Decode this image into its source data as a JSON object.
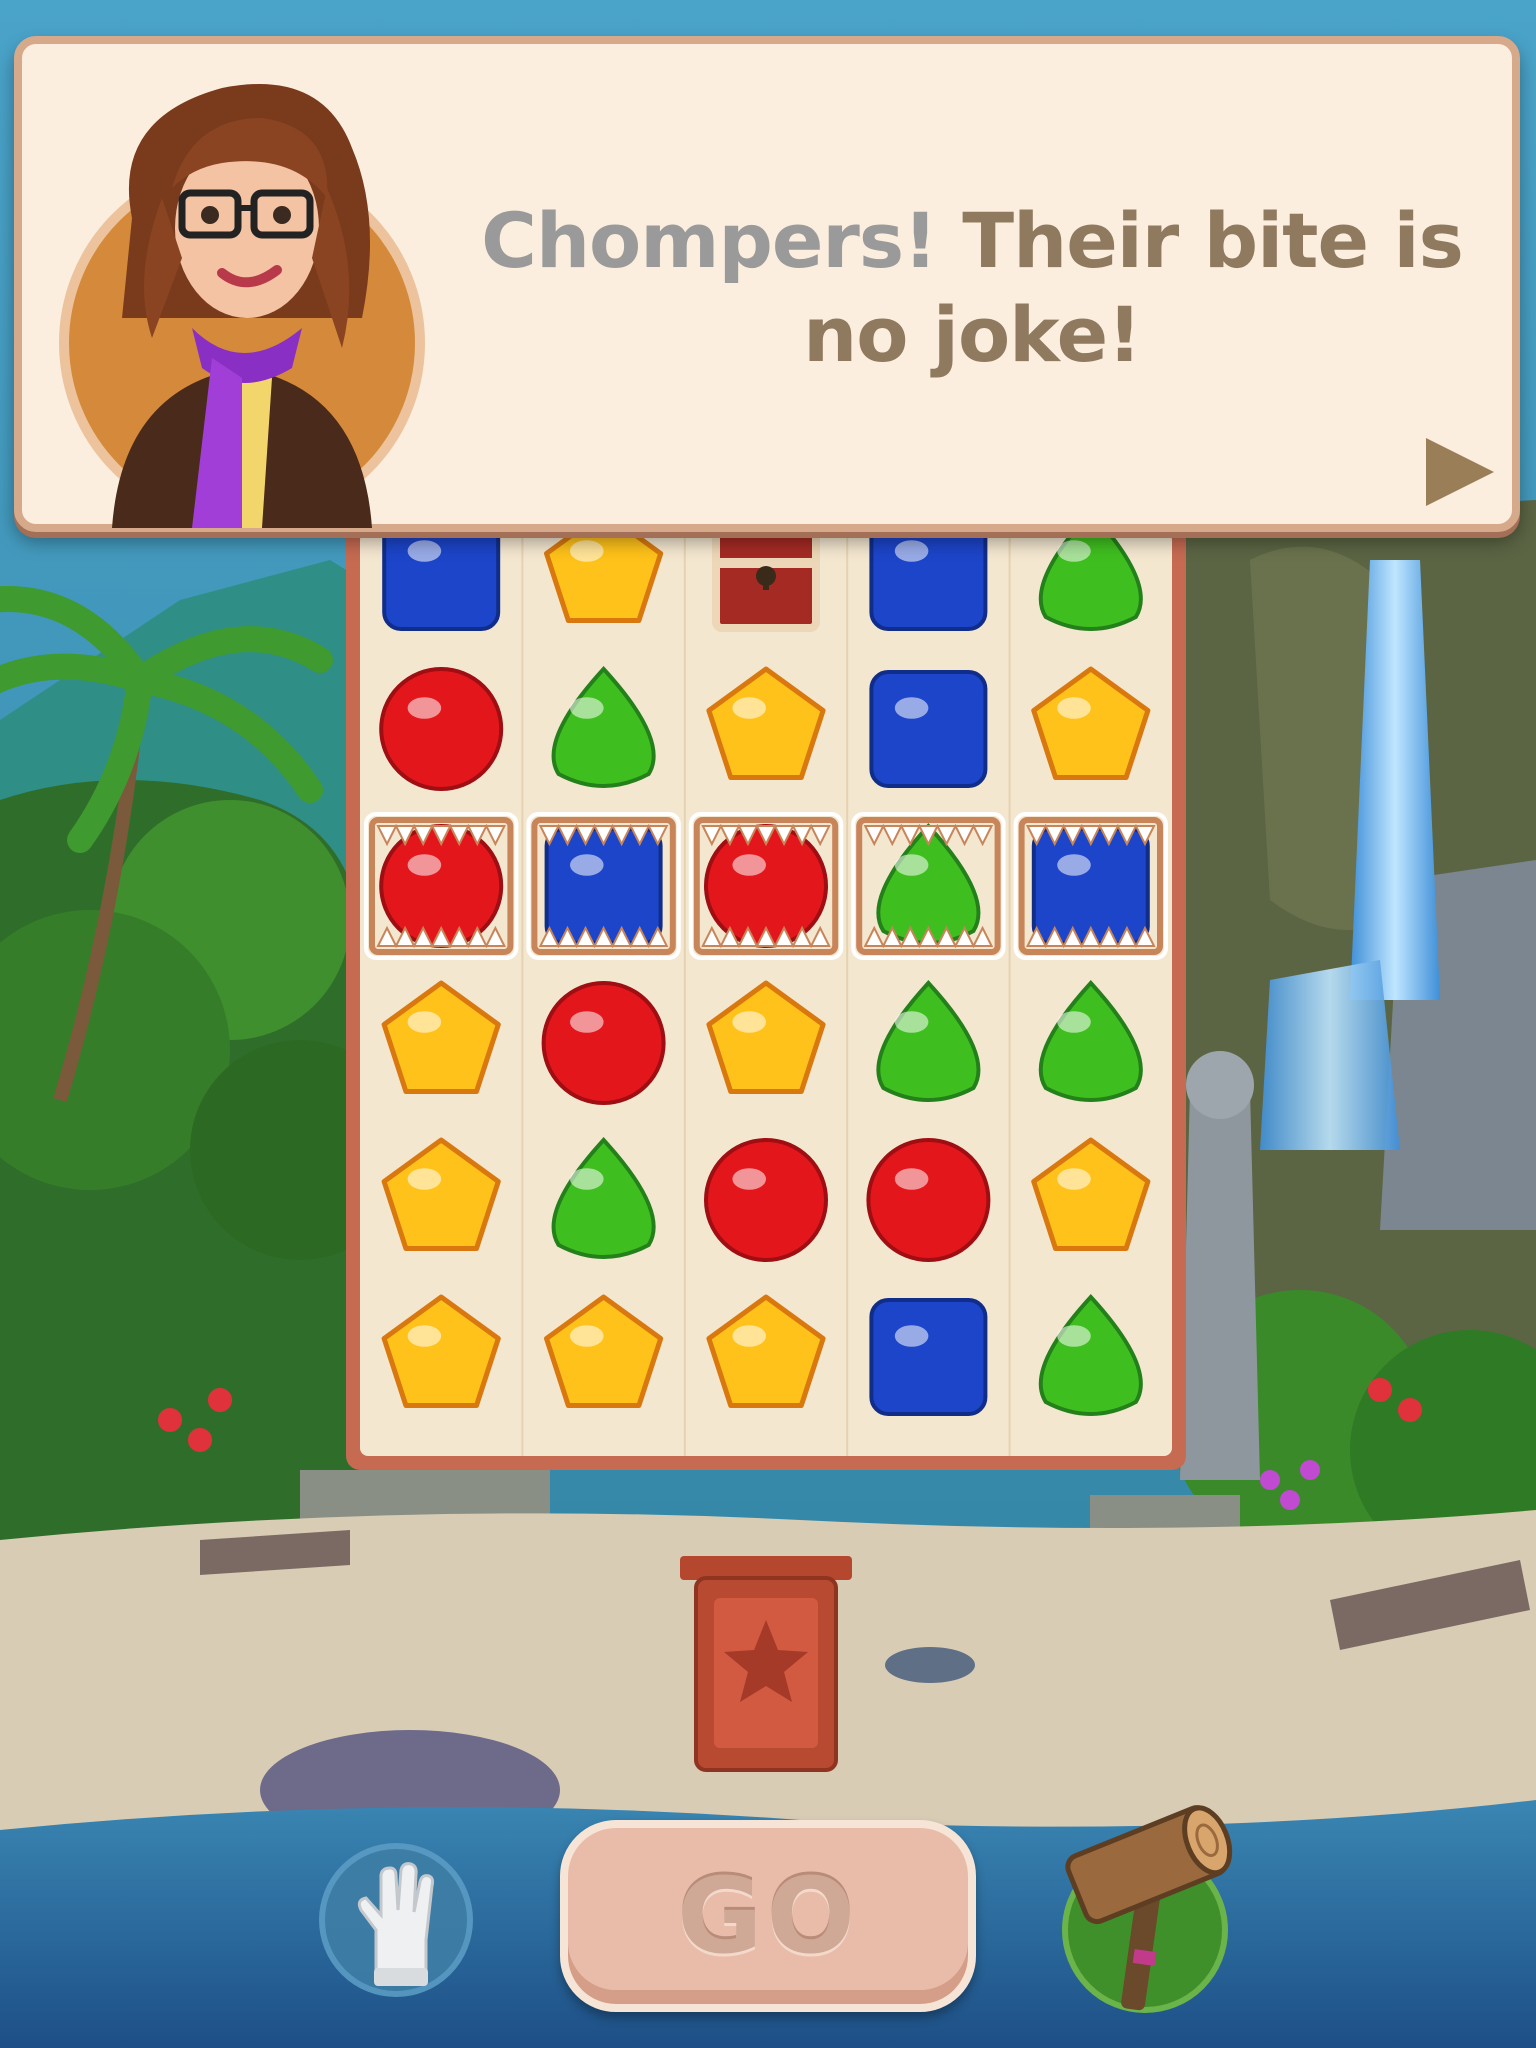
{
  "dialog": {
    "text_highlight": "Chompers!",
    "text_rest": "Their bite is no joke!",
    "next_icon": "play-arrow-icon"
  },
  "board": {
    "rows": 6,
    "cols": 5,
    "grid": [
      [
        "blue",
        "yellow",
        "chest",
        "blue",
        "green"
      ],
      [
        "red",
        "green",
        "yellow",
        "blue",
        "yellow"
      ],
      [
        "red",
        "blue",
        "red",
        "green",
        "blue"
      ],
      [
        "yellow",
        "red",
        "yellow",
        "green",
        "green"
      ],
      [
        "yellow",
        "green",
        "red",
        "red",
        "yellow"
      ],
      [
        "yellow",
        "yellow",
        "yellow",
        "blue",
        "green"
      ]
    ],
    "chomper_row": 2,
    "gem_colors": {
      "red": "#e3161c",
      "blue": "#1c45c9",
      "green": "#3fbf1f",
      "yellow": "#ffc21a"
    }
  },
  "boosters": {
    "left": {
      "icon": "glove-icon"
    },
    "right": {
      "icon": "hammer-icon"
    }
  },
  "go_button": {
    "label": "GO"
  },
  "collector": {
    "icon": "star-slot-icon"
  }
}
